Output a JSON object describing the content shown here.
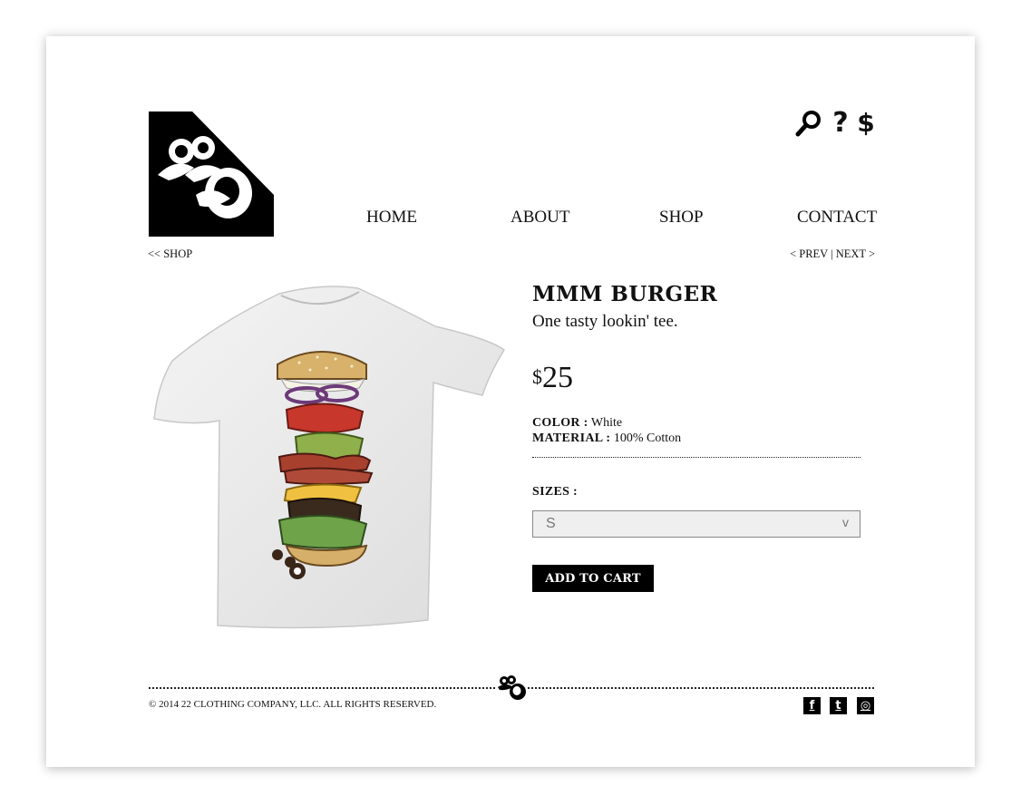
{
  "header": {
    "utility_icons": [
      "search-icon",
      "help-icon",
      "cart-icon"
    ],
    "help_glyph": "?",
    "cart_glyph": "$"
  },
  "nav": {
    "home": "HOME",
    "about": "ABOUT",
    "shop": "SHOP",
    "contact": "CONTACT"
  },
  "breadcrumb": {
    "back": "<< SHOP",
    "prev": "< PREV",
    "separator": "|",
    "next": "NEXT >"
  },
  "product": {
    "title": "MMM BURGER",
    "tagline": "One tasty lookin' tee.",
    "price_currency": "$",
    "price_amount": "25",
    "color_label": "COLOR :",
    "color_value": "White",
    "material_label": "MATERIAL :",
    "material_value": "100% Cotton",
    "sizes_label": "SIZES :",
    "selected_size": "S",
    "select_chevron": "v",
    "add_to_cart": "ADD TO CART"
  },
  "footer": {
    "copyright": "© 2014 22 CLOTHING COMPANY, LLC. ALL RIGHTS RESERVED.",
    "social": {
      "facebook": "f",
      "twitter": "t",
      "instagram": "◎"
    }
  },
  "colors": {
    "ink": "#111111",
    "button_bg": "#000000",
    "select_bg": "#efefef"
  }
}
